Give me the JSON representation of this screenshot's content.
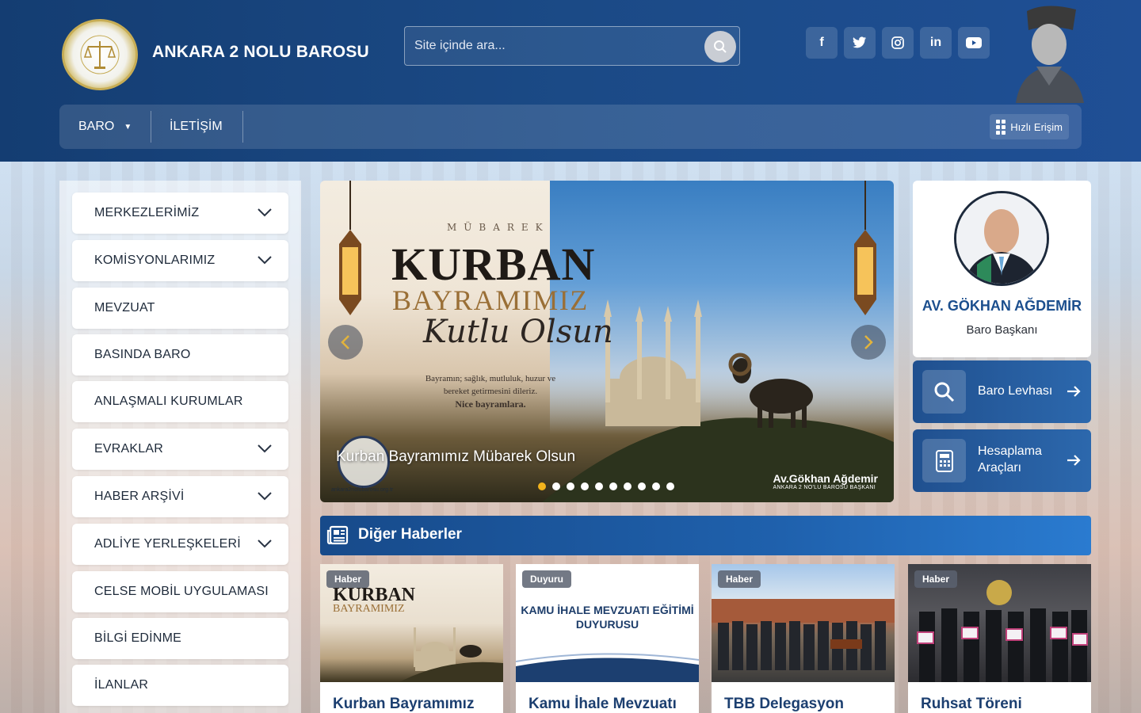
{
  "site": {
    "title": "ANKARA 2 NOLU BAROSU",
    "logo_text": "ANKARA 2 NOLU BAROSU"
  },
  "search": {
    "placeholder": "Site içinde ara..."
  },
  "socials": [
    {
      "icon": "facebook-icon",
      "glyph": "f"
    },
    {
      "icon": "twitter-icon",
      "glyph": "t"
    },
    {
      "icon": "instagram-icon",
      "glyph": "◎"
    },
    {
      "icon": "linkedin-icon",
      "glyph": "in"
    },
    {
      "icon": "youtube-icon",
      "glyph": "▶"
    }
  ],
  "nav": {
    "items": [
      "BARO",
      "İLETİŞİM"
    ],
    "quick_access": "Hızlı Erişim"
  },
  "sidebar": {
    "items": [
      {
        "label": "MERKEZLERİMİZ",
        "expandable": true
      },
      {
        "label": "KOMİSYONLARIMIZ",
        "expandable": true
      },
      {
        "label": "MEVZUAT",
        "expandable": false
      },
      {
        "label": "BASINDA BARO",
        "expandable": false
      },
      {
        "label": "ANLAŞMALI KURUMLAR",
        "expandable": false
      },
      {
        "label": "EVRAKLAR",
        "expandable": true
      },
      {
        "label": "HABER ARŞİVİ",
        "expandable": true
      },
      {
        "label": "ADLİYE YERLEŞKELERİ",
        "expandable": true
      },
      {
        "label": "CELSE MOBİL UYGULAMASI",
        "expandable": false
      },
      {
        "label": "BİLGİ EDİNME",
        "expandable": false
      },
      {
        "label": "İLANLAR",
        "expandable": false
      }
    ]
  },
  "slider": {
    "mubarek": "MÜBAREK",
    "kurban": "KURBAN",
    "bayramimiz": "BAYRAMIMIZ",
    "kutlu": "Kutlu Olsun",
    "wish_line1": "Bayramın; sağlık, mutluluk, huzur ve",
    "wish_line2": "bereket getirmesini dileriz.",
    "wish_line3": "Nice bayramlara.",
    "caption": "Kurban Bayramımız Mübarek Olsun",
    "signature": "Av.Gökhan Ağdemir",
    "signature_sub": "ANKARA 2 NO'LU BAROSU BAŞKANI",
    "url": "ankara2nolubarosu.org.tr",
    "dot_count": 10,
    "active_dot": 0
  },
  "president": {
    "name": "AV. GÖKHAN AĞDEMİR",
    "title": "Baro Başkanı"
  },
  "quick_links": [
    {
      "label": "Baro Levhası",
      "icon": "search-icon"
    },
    {
      "label": "Hesaplama Araçları",
      "icon": "calculator-icon"
    }
  ],
  "news": {
    "header": "Diğer Haberler",
    "cards": [
      {
        "badge": "Haber",
        "title": "Kurban Bayramımız"
      },
      {
        "badge": "Duyuru",
        "title": "Kamu İhale Mevzuatı",
        "image_text": "KAMU İHALE MEVZUATI EĞİTİMİ DUYURUSU"
      },
      {
        "badge": "Haber",
        "title": "TBB Delegasyon"
      },
      {
        "badge": "Haber",
        "title": "Ruhsat Töreni"
      }
    ]
  },
  "colors": {
    "header_blue": "#1b4a86",
    "accent_blue": "#1f61ad",
    "title_blue": "#1c4f8e",
    "active_dot": "#f2b31c"
  }
}
